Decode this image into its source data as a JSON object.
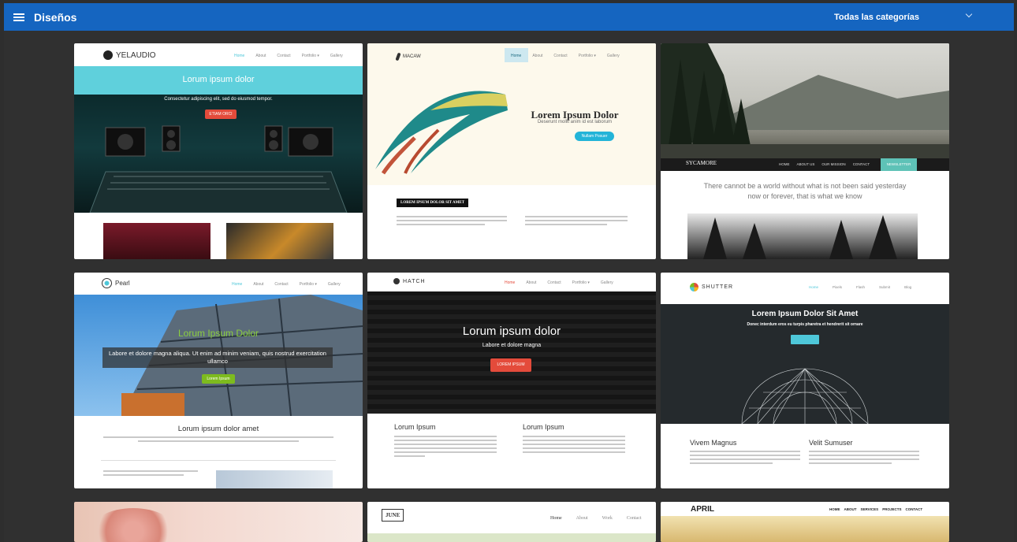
{
  "header": {
    "title": "Diseños",
    "category_select": "Todas las categorías"
  },
  "templates": [
    {
      "logo": "YELAUDIO",
      "nav": [
        "Home",
        "About",
        "Contact",
        "Portfolio ▾",
        "Gallery"
      ],
      "headline": "Lorum ipsum dolor",
      "subhead": "Consectetur adipiscing elit, sed do eiusmod tempor.",
      "button": "ETIAM ORCI"
    },
    {
      "logo": "MACAW",
      "nav": [
        "Home",
        "About",
        "Contact",
        "Portfolio ▾",
        "Gallery"
      ],
      "headline": "Lorem Ipsum Dolor",
      "subhead": "Deserunt mollit anim id est laborum",
      "button": "Nullam Posuer",
      "section_label": "LOREM IPSUM DOLOR SIT AMET"
    },
    {
      "logo": "SYCAMORE",
      "nav": [
        "HOME",
        "ABOUT US",
        "OUR MISSION",
        "CONTACT",
        "NEWSLETTER"
      ],
      "quote_line1": "There cannot be a world without what is not been said yesterday",
      "quote_line2": "now or forever, that is what we know"
    },
    {
      "logo": "Pearl",
      "nav": [
        "Home",
        "About",
        "Contact",
        "Portfolio ▾",
        "Gallery"
      ],
      "headline": "Lorum Ipsum Dolor",
      "subhead": "Labore et dolore magna aliqua. Ut enim ad minim veniam, quis nostrud exercitation ullamco",
      "button": "Lorem Ipsum",
      "section_title": "Lorum ipsum dolor amet"
    },
    {
      "logo": "HATCH",
      "nav": [
        "Home",
        "About",
        "Contact",
        "Portfolio ▾",
        "Gallery"
      ],
      "headline": "Lorum ipsum dolor",
      "subhead": "Labore et dolore magna",
      "button": "LOREM IPSUM",
      "col1_title": "Lorum Ipsum",
      "col2_title": "Lorum Ipsum"
    },
    {
      "logo": "SHUTTER",
      "nav": [
        "Home",
        "Pixels",
        "Flash",
        "Submit",
        "Blog"
      ],
      "headline": "Lorem Ipsum Dolor Sit Amet",
      "subhead": "Donec interdum eros eu turpis pharetra et hendrerit sit ornare",
      "col1_title": "Vivem Magnus",
      "col2_title": "Velit Sumuser"
    },
    {
      "logo": "JUNE",
      "nav": [
        "Home",
        "About",
        "Work",
        "Contact"
      ]
    },
    {
      "logo": "APRIL",
      "nav": [
        "HOME",
        "ABOUT",
        "SERVICES",
        "PROJECTS",
        "CONTACT"
      ]
    }
  ]
}
